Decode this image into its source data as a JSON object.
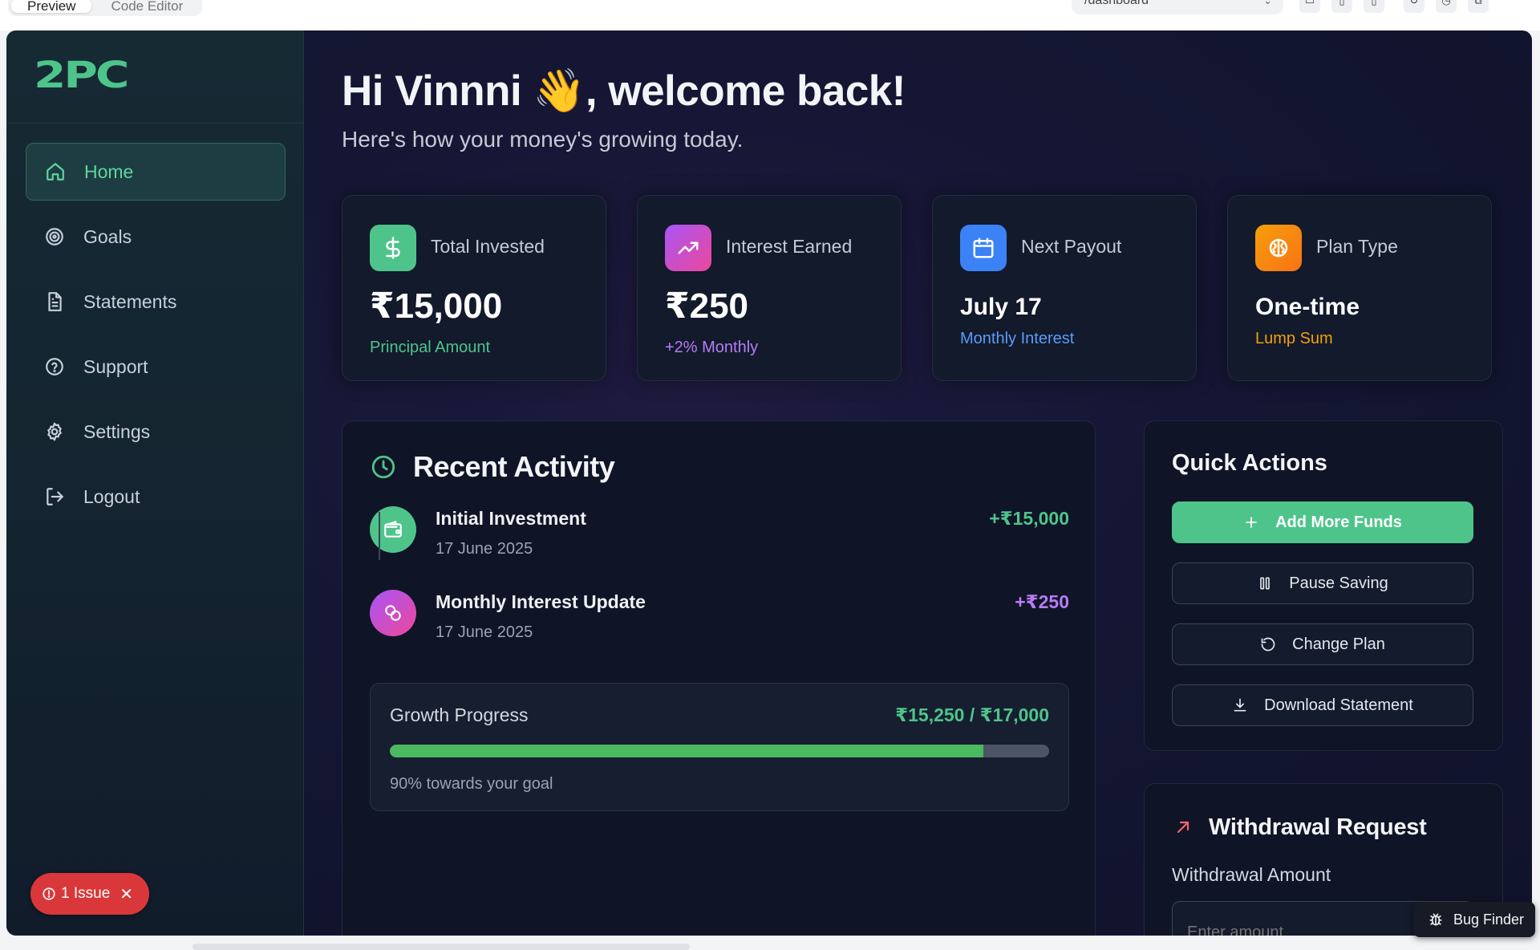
{
  "chrome": {
    "tabs": [
      {
        "label": "Preview"
      },
      {
        "label": "Code Editor"
      }
    ],
    "url": "/dashboard"
  },
  "brand": {
    "logo": "2PC",
    "accent": "#4ec48b"
  },
  "sidebar": {
    "items": [
      {
        "label": "Home",
        "icon": "home-icon",
        "active": true
      },
      {
        "label": "Goals",
        "icon": "target-icon"
      },
      {
        "label": "Statements",
        "icon": "document-icon"
      },
      {
        "label": "Support",
        "icon": "help-circle-icon"
      },
      {
        "label": "Settings",
        "icon": "gear-icon"
      },
      {
        "label": "Logout",
        "icon": "logout-icon"
      }
    ]
  },
  "issue": {
    "label": "1 Issue"
  },
  "header": {
    "title": "Hi Vinnni 👋, welcome back!",
    "subtitle": "Here's how your money's growing today."
  },
  "stats": [
    {
      "label": "Total Invested",
      "value": "₹15,000",
      "note": "Principal Amount",
      "icon": "dollar-icon",
      "color": "#4ec48b"
    },
    {
      "label": "Interest Earned",
      "value": "₹250",
      "note": "+2% Monthly",
      "icon": "trending-up-icon",
      "color": "#a855f7"
    },
    {
      "label": "Next Payout",
      "value": "July 17",
      "note": "Monthly Interest",
      "icon": "calendar-icon",
      "color": "#3b82f6"
    },
    {
      "label": "Plan Type",
      "value": "One-time",
      "note": "Lump Sum",
      "icon": "brain-icon",
      "color": "#f59e0b"
    }
  ],
  "recent": {
    "title": "Recent Activity",
    "items": [
      {
        "name": "Initial Investment",
        "date": "17 June 2025",
        "amount": "+₹15,000",
        "icon": "wallet-icon",
        "color": "#4ec48b"
      },
      {
        "name": "Monthly Interest Update",
        "date": "17 June 2025",
        "amount": "+₹250",
        "icon": "coins-icon",
        "color": "#a855f7"
      }
    ]
  },
  "growth": {
    "label": "Growth Progress",
    "value": "₹15,250 / ₹17,000",
    "progress_percent": 90,
    "note": "90% towards your goal"
  },
  "quick_actions": {
    "title": "Quick Actions",
    "buttons": [
      {
        "label": "Add More Funds",
        "icon": "plus-icon"
      },
      {
        "label": "Pause Saving",
        "icon": "pause-icon"
      },
      {
        "label": "Change Plan",
        "icon": "refresh-icon"
      },
      {
        "label": "Download Statement",
        "icon": "download-icon"
      }
    ]
  },
  "withdrawal": {
    "title": "Withdrawal Request",
    "field_label": "Withdrawal Amount",
    "placeholder": "Enter amount"
  },
  "bug_finder": {
    "label": "Bug Finder"
  }
}
